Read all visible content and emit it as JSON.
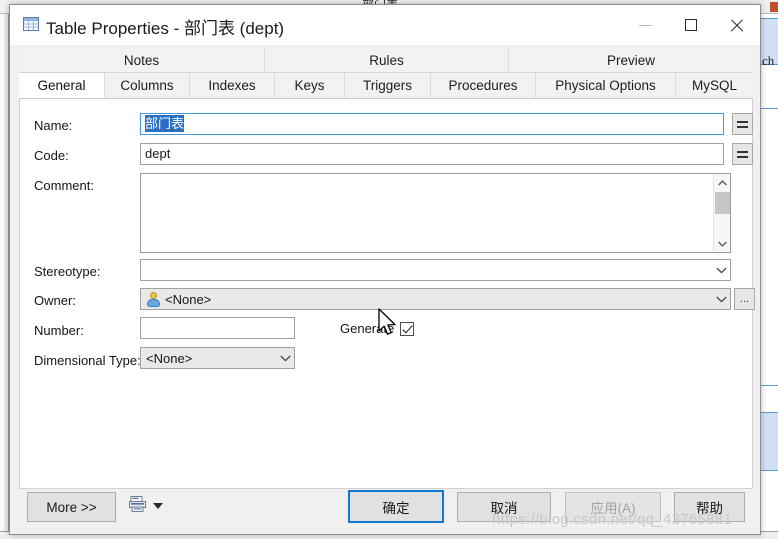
{
  "background": {
    "top_window_title": "部门表",
    "right_text": "ch"
  },
  "dialog": {
    "title": "Table Properties - 部门表 (dept)",
    "icon": "table-icon",
    "window_controls": {
      "minimize": "minimize-icon",
      "maximize": "maximize-icon",
      "close": "close-icon"
    }
  },
  "tabs": {
    "row1": [
      {
        "label": "Notes",
        "active": false
      },
      {
        "label": "Rules",
        "active": false
      },
      {
        "label": "Preview",
        "active": false
      }
    ],
    "row2": [
      {
        "label": "General",
        "active": true
      },
      {
        "label": "Columns",
        "active": false
      },
      {
        "label": "Indexes",
        "active": false
      },
      {
        "label": "Keys",
        "active": false
      },
      {
        "label": "Triggers",
        "active": false
      },
      {
        "label": "Procedures",
        "active": false
      },
      {
        "label": "Physical Options",
        "active": false
      },
      {
        "label": "MySQL",
        "active": false
      }
    ]
  },
  "form": {
    "name": {
      "label": "Name:",
      "value": "部门表",
      "selected": true,
      "side_button": "=",
      "side_button_name": "name-equals-button"
    },
    "code": {
      "label": "Code:",
      "value": "dept",
      "side_button": "=",
      "side_button_name": "code-equals-button"
    },
    "comment": {
      "label": "Comment:",
      "value": "",
      "scroll_up": "▲",
      "scroll_down": "▼"
    },
    "stereotype": {
      "label": "Stereotype:",
      "value": "",
      "arrow": "⌄"
    },
    "owner": {
      "label": "Owner:",
      "value": "<None>",
      "icon": "user-icon",
      "arrow": "⌄",
      "browse_button": "..."
    },
    "number": {
      "label": "Number:",
      "value": ""
    },
    "generate": {
      "label": "Generate",
      "checked": true
    },
    "dimensional_type": {
      "label": "Dimensional Type:",
      "value": "<None>",
      "arrow": "⌄"
    }
  },
  "footer": {
    "more": "More >>",
    "print_icon": "print-report-icon",
    "print_dropdown": "chevron-down-icon",
    "ok": "确定",
    "cancel": "取消",
    "apply": "应用(A)",
    "apply_disabled": true,
    "help": "帮助"
  },
  "watermark": "https://blog.csdn.net/qq_43765881"
}
